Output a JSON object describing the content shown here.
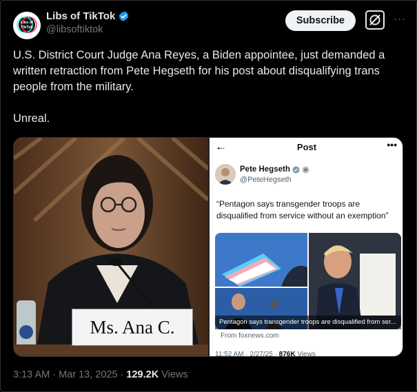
{
  "account": {
    "name": "Libs of TikTok",
    "handle": "@libsoftiktok",
    "verified": true,
    "verified_color": "#1d9bf0",
    "avatar_text": "Libs of TikTok"
  },
  "actions": {
    "subscribe_label": "Subscribe",
    "grok_icon": "grok-icon",
    "more_icon": "more-dots-icon",
    "more_glyph": "···"
  },
  "tweet": {
    "paragraph1": "U.S. District Court Judge Ana Reyes, a Biden appointee, just demanded a written retraction from Pete Hegseth for his post about disqualifying trans people from the military.",
    "paragraph2": "Unreal."
  },
  "media": {
    "left_photo": {
      "nameplate": "Ms. Ana C. Reyes"
    },
    "right_screenshot": {
      "back_glyph": "←",
      "title": "Post",
      "more_glyph": "•••",
      "author_name": "Pete Hegseth",
      "author_handle": "@PeteHegseth",
      "quote": "“Pentagon says transgender troops are disqualified from service without an exemption”",
      "link_caption": "Pentagon says transgender troops are disqualified from ser...",
      "link_source": "From foxnews.com",
      "time": "11:52 AM · 2/27/25 ·",
      "views_count": "876K",
      "views_label": "Views"
    }
  },
  "footer": {
    "timestamp": "3:13 AM · Mar 13, 2025 ·",
    "views_count": "129.2K",
    "views_label": "Views"
  }
}
